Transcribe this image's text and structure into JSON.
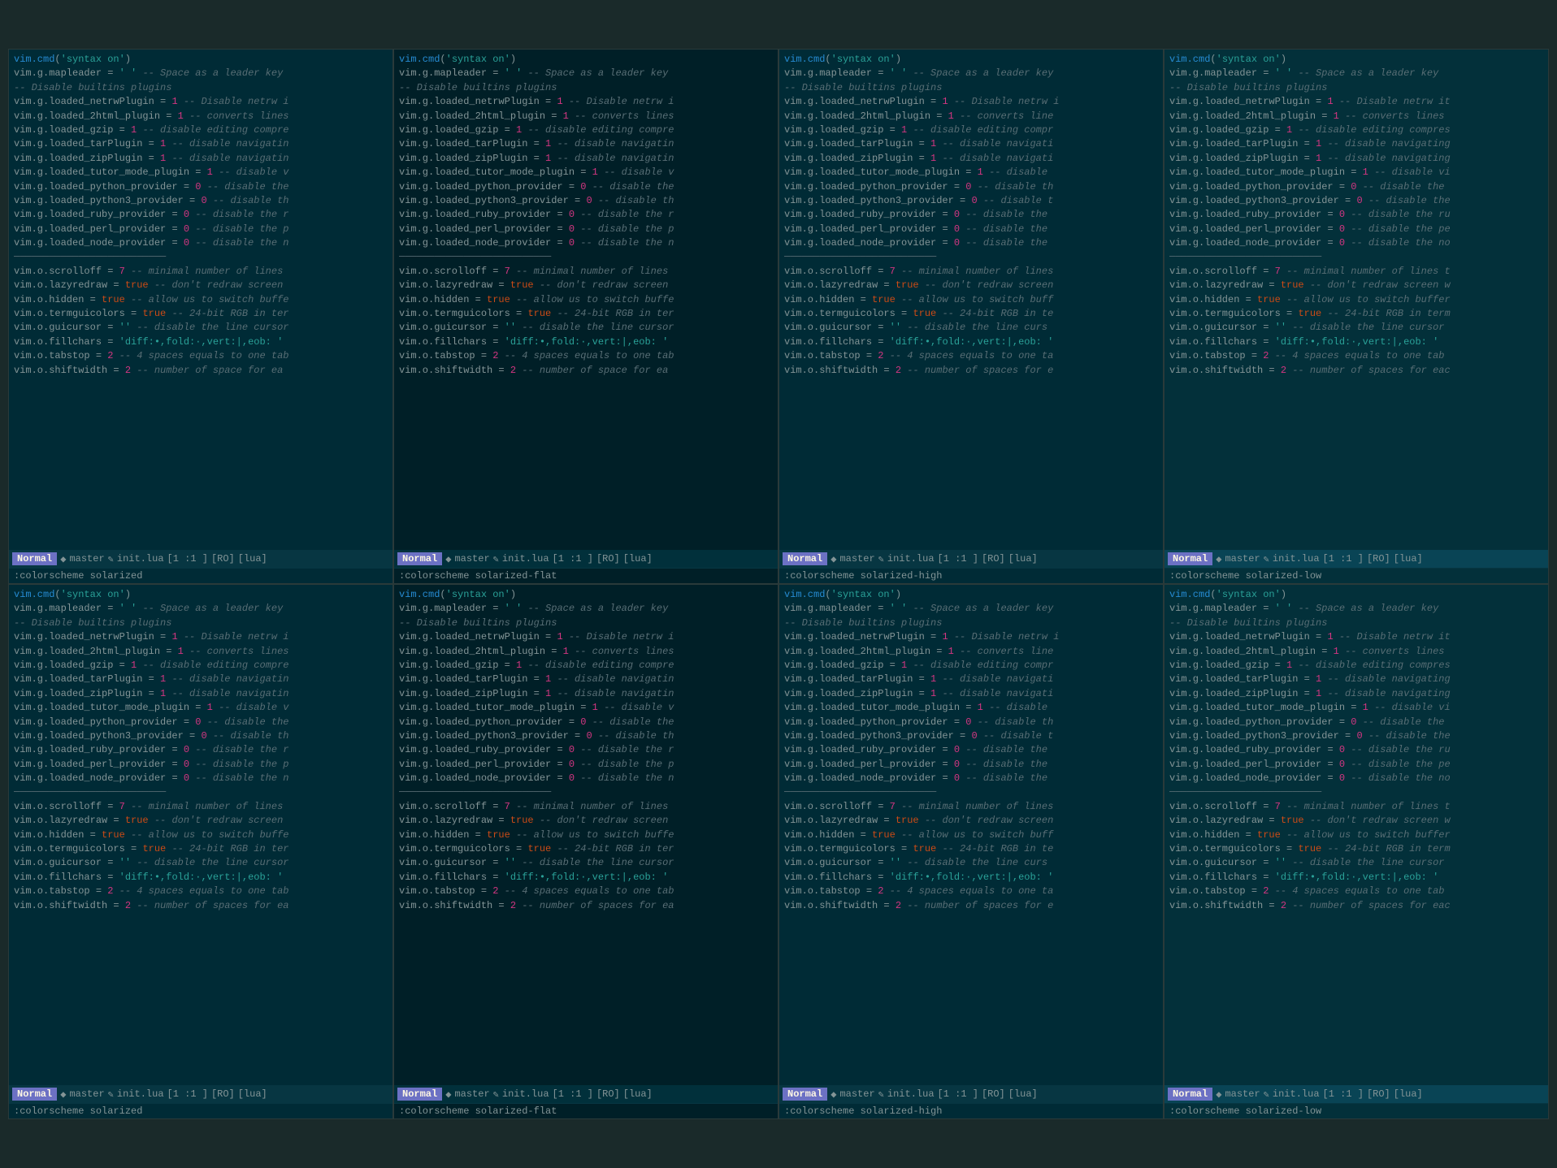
{
  "panes": [
    {
      "id": "top-left",
      "variant": "solarized",
      "colorscheme": ":colorscheme solarized",
      "status": {
        "mode": "Normal",
        "git_icon": "◆",
        "branch": "master",
        "pencil": "✎",
        "file": "init.lua",
        "pos": "[1  :1 ]",
        "ro": "[RO]",
        "type": "[lua]"
      }
    },
    {
      "id": "top-mid-left",
      "variant": "solarized-flat",
      "colorscheme": ":colorscheme solarized-flat",
      "status": {
        "mode": "Normal",
        "git_icon": "◆",
        "branch": "master",
        "pencil": "✎",
        "file": "init.lua",
        "pos": "[1  :1 ]",
        "ro": "[RO]",
        "type": "[lua]"
      }
    },
    {
      "id": "top-mid-right",
      "variant": "solarized-high",
      "colorscheme": ":colorscheme solarized-high",
      "status": {
        "mode": "Normal",
        "git_icon": "◆",
        "branch": "master",
        "pencil": "✎",
        "file": "init.lua",
        "pos": "[1  :1 ]",
        "ro": "[RO]",
        "type": "[lua]"
      }
    },
    {
      "id": "top-right",
      "variant": "solarized-low",
      "colorscheme": ":colorscheme solarized-low",
      "status": {
        "mode": "Normal",
        "git_icon": "◆",
        "branch": "master",
        "pencil": "✎",
        "file": "init.lua",
        "pos": "[1  :1 ]",
        "ro": "[RO]",
        "type": "[lua]"
      }
    },
    {
      "id": "bot-left",
      "variant": "solarized",
      "colorscheme": ":colorscheme solarized",
      "status": {
        "mode": "Normal",
        "git_icon": "◆",
        "branch": "master",
        "pencil": "✎",
        "file": "init.lua",
        "pos": "[1  :1 ]",
        "ro": "[RO]",
        "type": "[lua]"
      }
    },
    {
      "id": "bot-mid-left",
      "variant": "solarized-flat",
      "colorscheme": ":colorscheme solarized-flat",
      "status": {
        "mode": "Normal",
        "git_icon": "◆",
        "branch": "master",
        "pencil": "✎",
        "file": "init.lua",
        "pos": "[1  :1 ]",
        "ro": "[RO]",
        "type": "[lua]"
      }
    },
    {
      "id": "bot-mid-right",
      "variant": "solarized-high",
      "colorscheme": ":colorscheme solarized-high",
      "status": {
        "mode": "Normal",
        "git_icon": "◆",
        "branch": "master",
        "pencil": "✎",
        "file": "init.lua",
        "pos": "[1  :1 ]",
        "ro": "[RO]",
        "type": "[lua]"
      }
    },
    {
      "id": "bot-right",
      "variant": "solarized-low",
      "colorscheme": ":colorscheme solarized-low",
      "status": {
        "mode": "Normal",
        "git_icon": "◆",
        "branch": "master",
        "pencil": "✎",
        "file": "init.lua",
        "pos": "[1  :1 ]",
        "ro": "[RO]",
        "type": "[lua]"
      }
    }
  ],
  "labels": {
    "normal": "Normal",
    "separator": "──────────────────────────"
  }
}
